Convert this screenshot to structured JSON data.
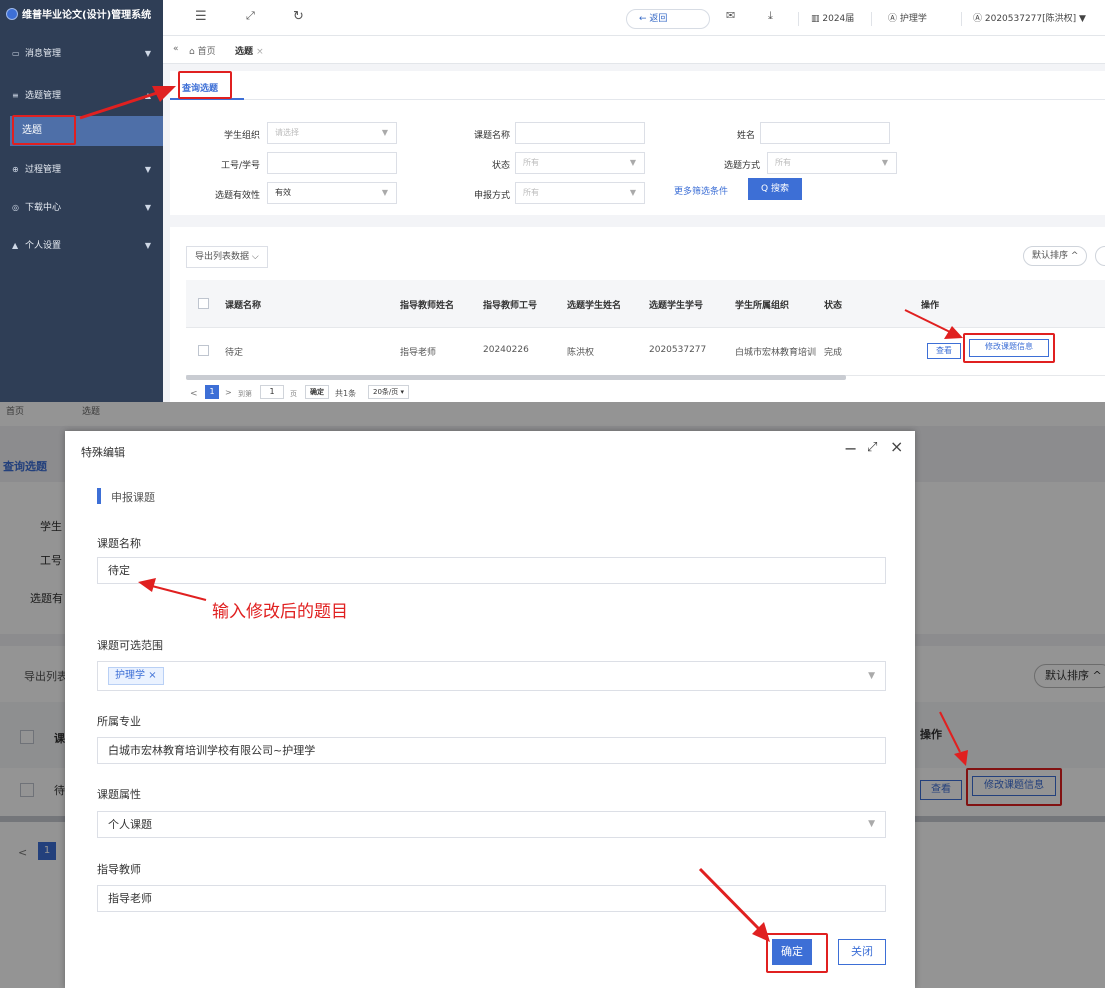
{
  "app_title": "维普毕业论文(设计)管理系统",
  "sidebar": {
    "items": [
      {
        "label": "消息管理",
        "icon": "message-icon"
      },
      {
        "label": "选题管理",
        "icon": "list-icon"
      },
      {
        "label": "过程管理",
        "icon": "process-icon"
      },
      {
        "label": "下载中心",
        "icon": "download-icon"
      },
      {
        "label": "个人设置",
        "icon": "person-icon"
      }
    ],
    "sub_item": "选题"
  },
  "header": {
    "back": "← 返回",
    "year": "2024届",
    "major": "护理学",
    "user": "2020537277[陈洪权]"
  },
  "tabs": {
    "home": "首页",
    "current": "选题"
  },
  "page_tab": "查询选题",
  "filters": {
    "org_label": "学生组织",
    "org_placeholder": "请选择",
    "topic_label": "课题名称",
    "name_label": "姓名",
    "id_label": "工号/学号",
    "status_label": "状态",
    "status_value": "所有",
    "method_label": "选题方式",
    "method_value": "所有",
    "valid_label": "选题有效性",
    "valid_value": "有效",
    "apply_label": "申报方式",
    "apply_value": "所有",
    "more": "更多筛选条件",
    "search": "Q 搜索"
  },
  "toolbar": {
    "export": "导出列表数据",
    "sort": "默认排序 ^"
  },
  "table": {
    "headers": [
      "课题名称",
      "指导教师姓名",
      "指导教师工号",
      "选题学生姓名",
      "选题学生学号",
      "学生所属组织",
      "状态",
      "操作"
    ],
    "row": [
      "待定",
      "指导老师",
      "20240226",
      "陈洪权",
      "2020537277",
      "白城市宏林教育培训",
      "完成"
    ],
    "view": "查看",
    "edit": "修改课题信息"
  },
  "pager": {
    "page": "1",
    "goto": "到第",
    "page_unit": "页",
    "confirm": "确定",
    "total": "共1条",
    "size": "20条/页"
  },
  "modal": {
    "title": "特殊编辑",
    "section": "申报课题",
    "f1_label": "课题名称",
    "f1_value": "待定",
    "annotation": "输入修改后的题目",
    "f2_label": "课题可选范围",
    "f2_tag": "护理学",
    "f3_label": "所属专业",
    "f3_value": "白城市宏林教育培训学校有限公司~护理学",
    "f4_label": "课题属性",
    "f4_value": "个人课题",
    "f5_label": "指导教师",
    "f5_value": "指导老师",
    "confirm": "确定",
    "close": "关闭"
  },
  "bg": {
    "home": "首页",
    "tab": "选题",
    "page_tab": "查询选题",
    "l1": "学生",
    "l2": "工号",
    "l3": "选题有",
    "export": "导出列表",
    "sort": "默认排序 ^",
    "h1": "课",
    "r1": "待",
    "op": "操作",
    "view": "查看",
    "edit": "修改课题信息",
    "page": "1"
  },
  "colors": {
    "sidebar": "#2f3e56",
    "accent": "#3d6fd6",
    "highlight": "#e02020"
  }
}
